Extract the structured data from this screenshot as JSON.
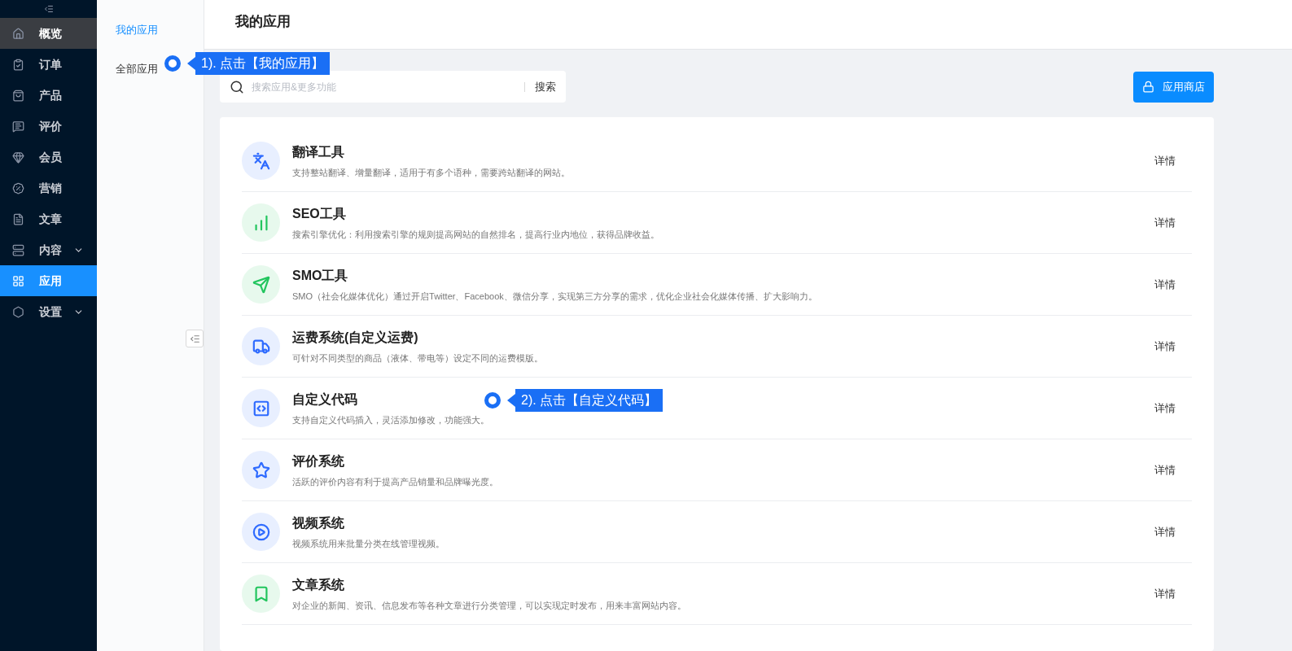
{
  "sidebar": {
    "items": [
      {
        "label": "概览",
        "selected": false,
        "highlighted": true,
        "expandable": false
      },
      {
        "label": "订单",
        "selected": false,
        "highlighted": false,
        "expandable": false
      },
      {
        "label": "产品",
        "selected": false,
        "highlighted": false,
        "expandable": false
      },
      {
        "label": "评价",
        "selected": false,
        "highlighted": false,
        "expandable": false
      },
      {
        "label": "会员",
        "selected": false,
        "highlighted": false,
        "expandable": false
      },
      {
        "label": "营销",
        "selected": false,
        "highlighted": false,
        "expandable": false
      },
      {
        "label": "文章",
        "selected": false,
        "highlighted": false,
        "expandable": false
      },
      {
        "label": "内容",
        "selected": false,
        "highlighted": false,
        "expandable": true
      },
      {
        "label": "应用",
        "selected": true,
        "highlighted": false,
        "expandable": false
      },
      {
        "label": "设置",
        "selected": false,
        "highlighted": false,
        "expandable": true
      }
    ]
  },
  "subnav": {
    "items": [
      {
        "label": "我的应用",
        "selected": true
      },
      {
        "label": "全部应用",
        "selected": false
      }
    ]
  },
  "page": {
    "title": "我的应用"
  },
  "search": {
    "placeholder": "搜索应用&更多功能",
    "button": "搜索"
  },
  "store_button": "应用商店",
  "apps": [
    {
      "title": "翻译工具",
      "description": "支持整站翻译、增量翻译，适用于有多个语种，需要跨站翻译的网站。",
      "action": "详情",
      "color": "#2f6bff"
    },
    {
      "title": "SEO工具",
      "description": "搜索引擎优化：利用搜索引擎的规则提高网站的自然排名，提高行业内地位，获得品牌收益。",
      "action": "详情",
      "color": "#22c55e"
    },
    {
      "title": "SMO工具",
      "description": "SMO（社会化媒体优化）通过开启Twitter、Facebook、微信分享，实现第三方分享的需求，优化企业社会化媒体传播、扩大影响力。",
      "action": "详情",
      "color": "#22c55e"
    },
    {
      "title": "运费系统(自定义运费)",
      "description": "可针对不同类型的商品（液体、带电等）设定不同的运费模版。",
      "action": "详情",
      "color": "#2f6bff"
    },
    {
      "title": "自定义代码",
      "description": "支持自定义代码插入，灵活添加修改，功能强大。",
      "action": "详情",
      "color": "#2f6bff"
    },
    {
      "title": "评价系统",
      "description": "活跃的评价内容有利于提高产品销量和品牌曝光度。",
      "action": "详情",
      "color": "#2f6bff"
    },
    {
      "title": "视频系统",
      "description": "视频系统用来批量分类在线管理视频。",
      "action": "详情",
      "color": "#2f6bff"
    },
    {
      "title": "文章系统",
      "description": "对企业的新闻、资讯、信息发布等各种文章进行分类管理，可以实现定时发布，用来丰富网站内容。",
      "action": "详情",
      "color": "#22c55e"
    }
  ],
  "callouts": [
    {
      "text": "1). 点击【我的应用】"
    },
    {
      "text": "2). 点击【自定义代码】"
    }
  ]
}
